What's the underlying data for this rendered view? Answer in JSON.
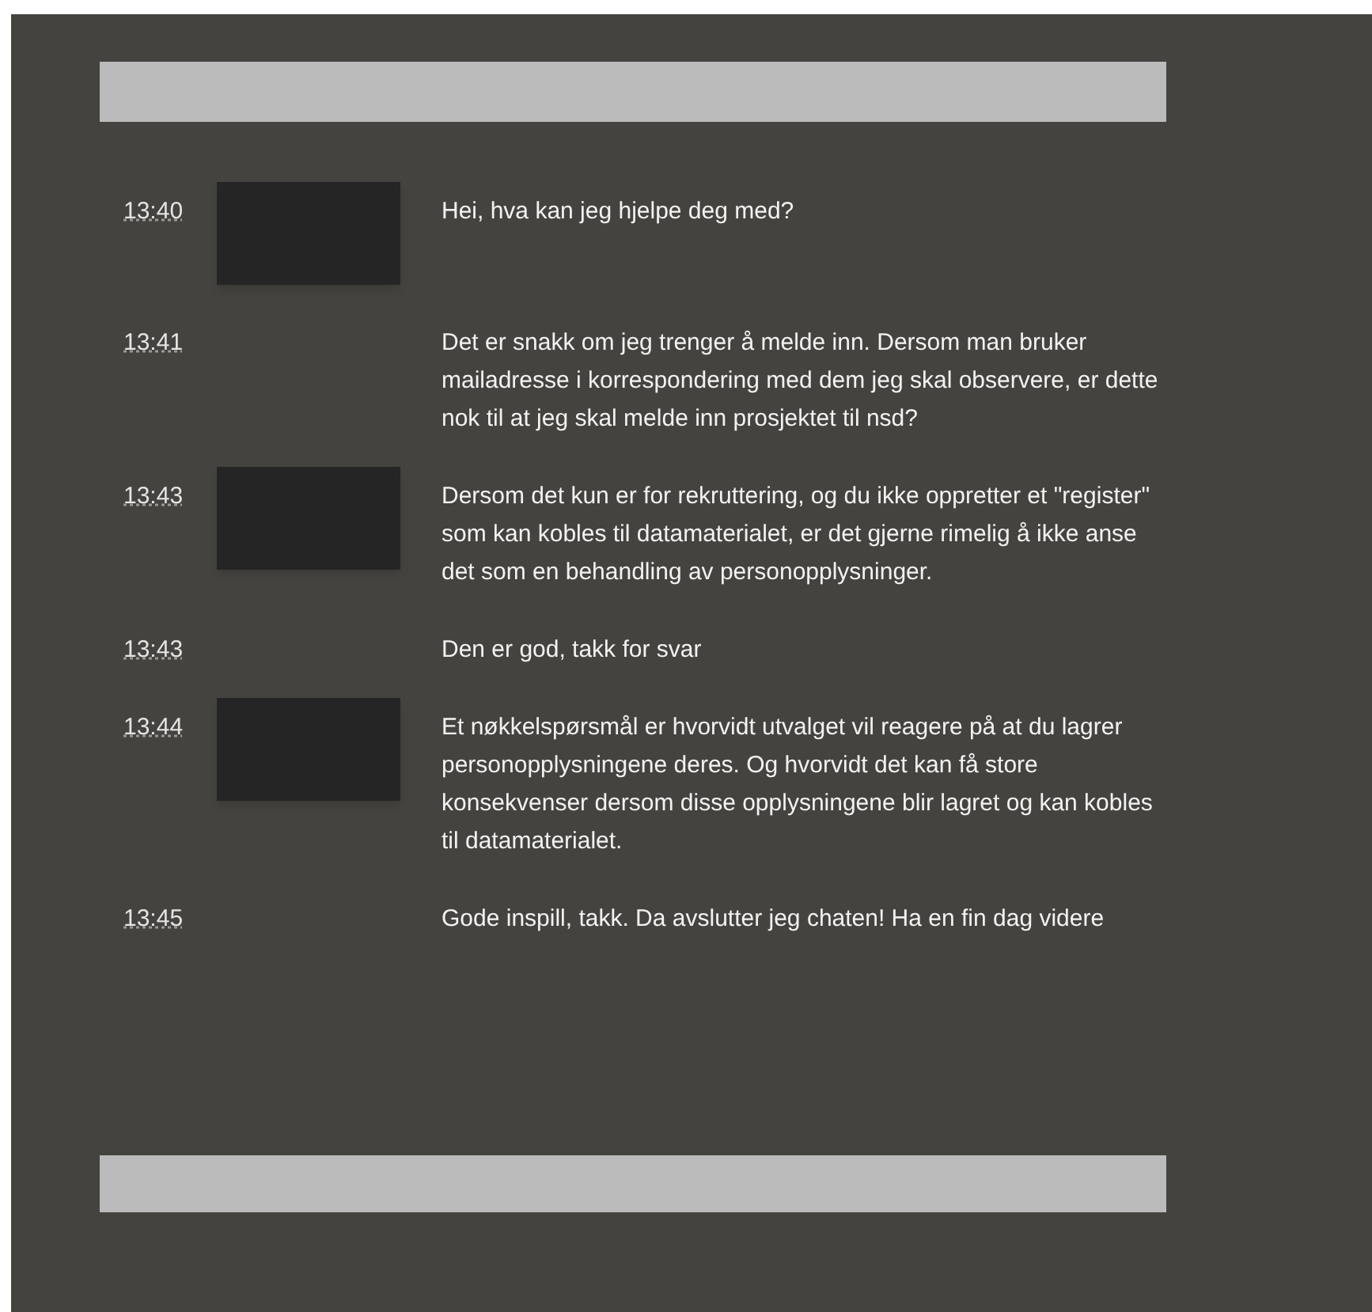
{
  "messages": [
    {
      "time": "13:40",
      "kind": "agent",
      "text": "Hei, hva kan jeg hjelpe deg med?"
    },
    {
      "time": "13:41",
      "kind": "user",
      "text": "Det er snakk om jeg trenger å melde inn. Dersom man bruker mailadresse i korrespondering med dem jeg skal observere, er dette nok til at jeg skal melde inn prosjektet til nsd?"
    },
    {
      "time": "13:43",
      "kind": "agent",
      "text": "Dersom det kun er for rekruttering, og du ikke oppretter et \"register\" som kan kobles til datamaterialet, er det gjerne rimelig å ikke anse det som en behandling av personopplysninger."
    },
    {
      "time": "13:43",
      "kind": "user",
      "text": "Den er god, takk for svar"
    },
    {
      "time": "13:44",
      "kind": "agent",
      "text": "Et nøkkelspørsmål er hvorvidt utvalget vil reagere på at du lagrer personopplysningene deres. Og hvorvidt det kan få store konsekvenser dersom disse opplysningene blir lagret og kan kobles til datamaterialet."
    },
    {
      "time": "13:45",
      "kind": "user",
      "text": "Gode inspill, takk. Da avslutter jeg chaten! Ha en fin dag videre"
    }
  ]
}
